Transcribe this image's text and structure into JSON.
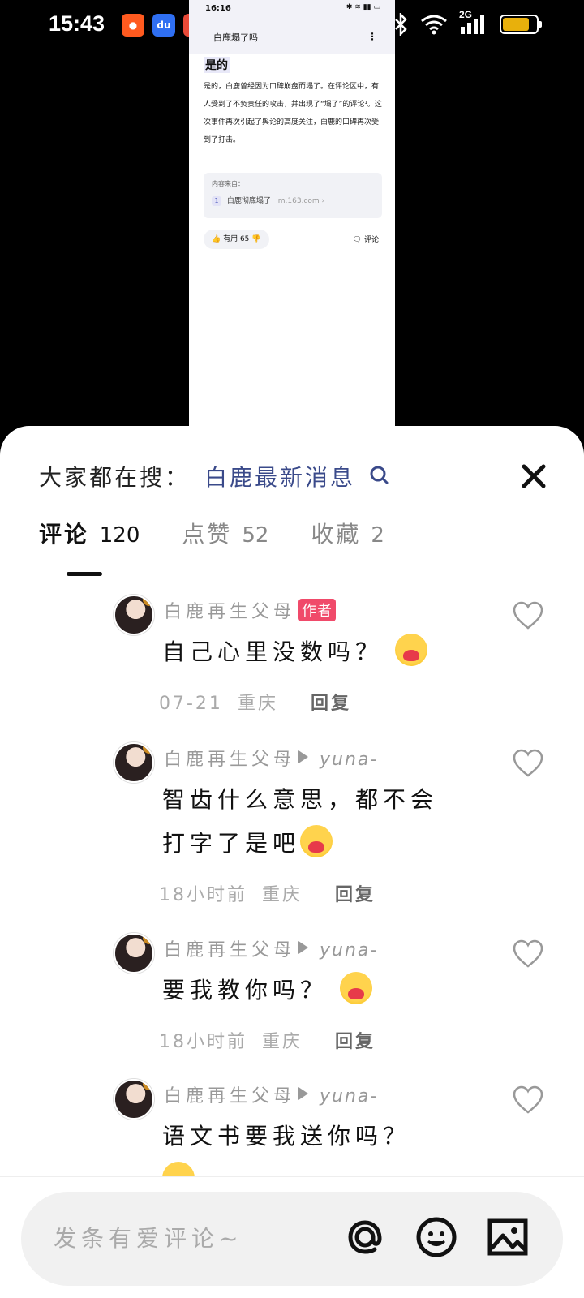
{
  "status_bar": {
    "time": "15:43",
    "apps": [
      {
        "name": "kuaishou-icon",
        "color": "#ff5a1f"
      },
      {
        "name": "baidu-icon",
        "color": "#2f6ff2"
      },
      {
        "name": "weibo-icon",
        "color": "#e84a38"
      }
    ],
    "network": "2G",
    "battery_level": 0.8
  },
  "mini_screenshot": {
    "time": "16:16",
    "title": "白鹿塌了吗",
    "heading": "是的",
    "body": "是的，白鹿曾经因为口碑崩盘而塌了。在评论区中，有人受到了不负责任的攻击，并出现了“塌了”的评论¹。这次事件再次引起了舆论的高度关注，白鹿的口碑再次受到了打击。",
    "ref_label": "内容来自：",
    "ref_num": "1",
    "ref_text": "白鹿彻底塌了",
    "ref_source": "m.163.com",
    "like_text": "有用 65",
    "comment_text": "评论"
  },
  "sheet": {
    "search_hint": "大家都在搜：",
    "search_link": "白鹿最新消息",
    "tabs": [
      {
        "label": "评论",
        "count": "120",
        "active": true
      },
      {
        "label": "点赞",
        "count": "52",
        "active": false
      },
      {
        "label": "收藏",
        "count": "2",
        "active": false
      }
    ],
    "comments": [
      {
        "username": "白鹿再生父母",
        "badge": "作者",
        "reply_to": "",
        "text": "自己心里没数吗？",
        "date": "07-21",
        "location": "重庆",
        "reply_label": "回复"
      },
      {
        "username": "白鹿再生父母",
        "badge": "",
        "reply_to": "yuna-",
        "text": "智齿什么意思，都不会打字了是吧",
        "date": "18小时前",
        "location": "重庆",
        "reply_label": "回复"
      },
      {
        "username": "白鹿再生父母",
        "badge": "",
        "reply_to": "yuna-",
        "text": "要我教你吗？",
        "date": "18小时前",
        "location": "重庆",
        "reply_label": "回复"
      },
      {
        "username": "白鹿再生父母",
        "badge": "",
        "reply_to": "yuna-",
        "text": "语文书要我送你吗？",
        "date": "",
        "location": "",
        "reply_label": ""
      }
    ],
    "input_placeholder": "发条有爱评论~"
  }
}
